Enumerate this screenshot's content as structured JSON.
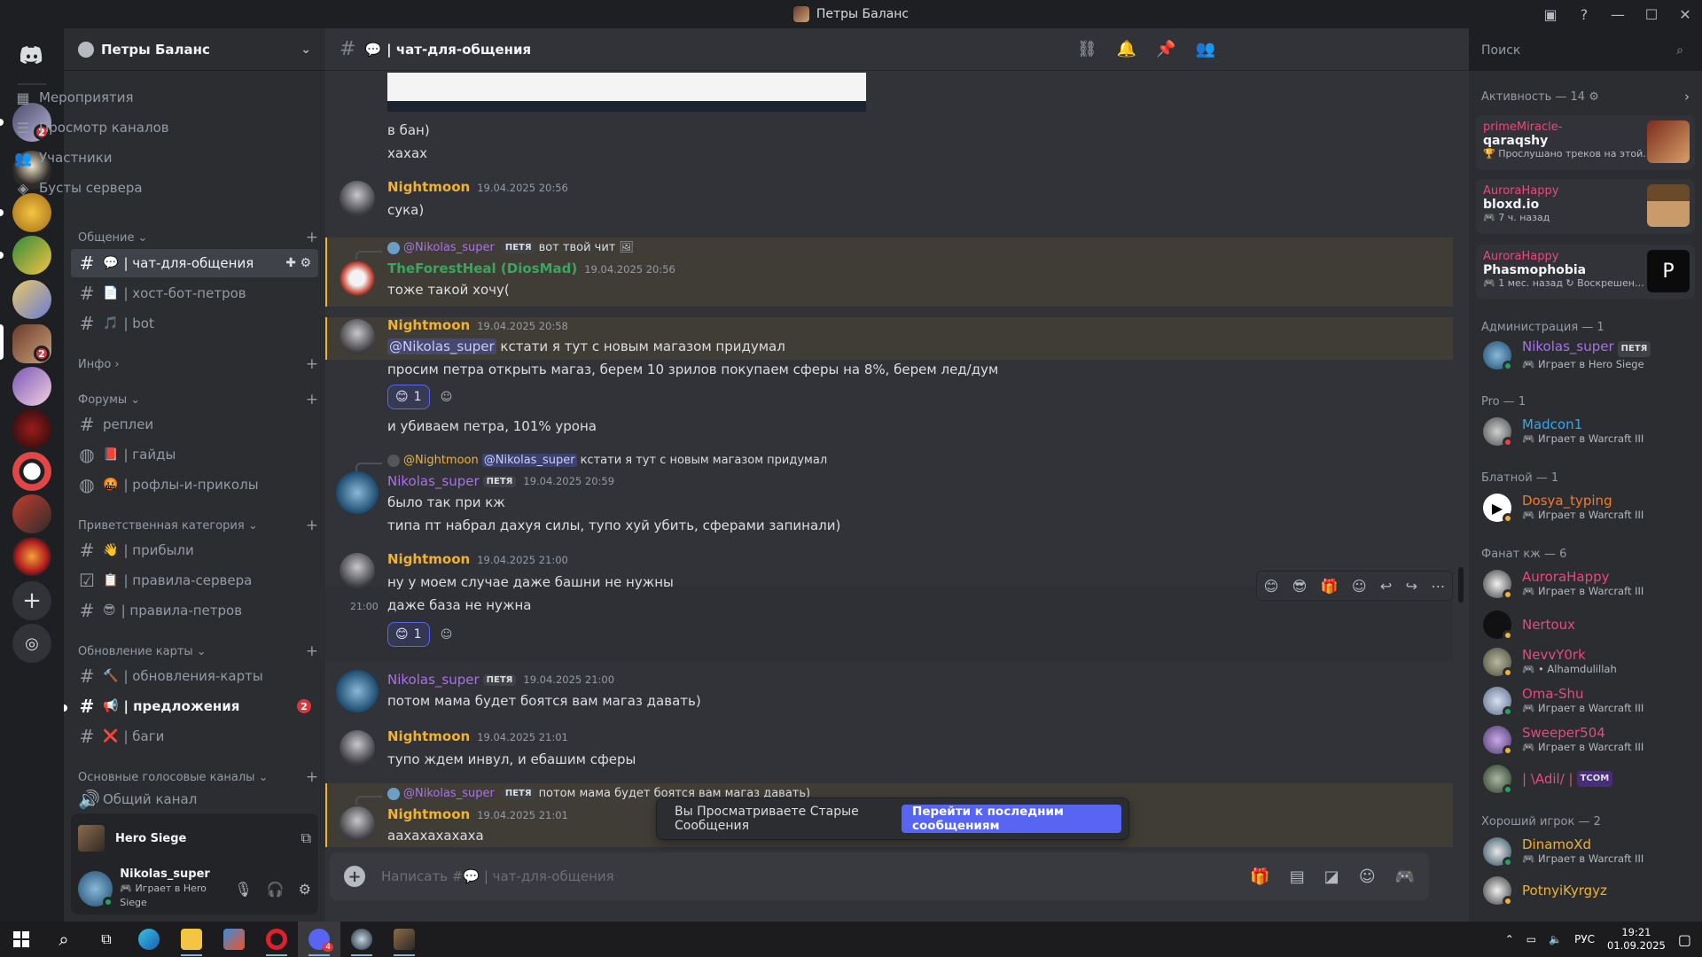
{
  "window": {
    "title": "Петры Баланс"
  },
  "server": {
    "name": "Петры Баланс"
  },
  "server_rail": {
    "badges": [
      "2",
      "2"
    ]
  },
  "nav": [
    {
      "label": "Мероприятия",
      "icon": "calendar-icon"
    },
    {
      "label": "Просмотр каналов",
      "icon": "channels-browse-icon"
    },
    {
      "label": "Участники",
      "icon": "members-icon"
    },
    {
      "label": "Бусты сервера",
      "icon": "boost-icon"
    }
  ],
  "categories": {
    "c1": "Общение",
    "c2": "Инфо",
    "c3": "Форумы",
    "c4": "Приветственная категория",
    "c5": "Обновление карты",
    "c6": "Основные голосовые каналы"
  },
  "channels": {
    "chat": {
      "emoji": "💬",
      "name": "| чат-для-общения"
    },
    "host": {
      "emoji": "📄",
      "name": "| хост-бот-петров"
    },
    "bot": {
      "emoji": "🎵",
      "name": "| bot"
    },
    "replays": {
      "name": "реплеи"
    },
    "guides": {
      "emoji": "📕",
      "name": "| гайды"
    },
    "memes": {
      "emoji": "🤬",
      "name": "| рофлы-и-приколы"
    },
    "arrived": {
      "emoji": "👋",
      "name": "| прибыли"
    },
    "rules": {
      "emoji": "📋",
      "name": "| правила-сервера"
    },
    "rules_p": {
      "emoji": "😎",
      "name": "| правила-петров"
    },
    "updates": {
      "emoji": "🔨",
      "name": "| обновления-карты"
    },
    "suggest": {
      "emoji": "📢",
      "name": "| предложения",
      "badge": "2"
    },
    "bugs": {
      "emoji": "❌",
      "name": "| баги"
    },
    "voice": {
      "name": "Общий канал"
    }
  },
  "activity_bar": {
    "game": "Hero Siege"
  },
  "user_panel": {
    "name": "Nikolas_super",
    "status": "Играет в Hero Siege"
  },
  "chat_header": {
    "emoji": "💬",
    "name": "| чат-для-общения"
  },
  "search": {
    "placeholder": "Поиск"
  },
  "messages": {
    "m0": {
      "l1": "в бан)",
      "l2": "хахах"
    },
    "m1": {
      "user": "Nightmoon",
      "time": "19.04.2025 20:56",
      "text": "сука)"
    },
    "m2": {
      "reply_user": "@Nikolas_super",
      "reply_tag": "ПЕТЯ",
      "reply_text": "вот твой чит",
      "user": "TheForestHeal (DiosMad)",
      "time": "19.04.2025 20:56",
      "text": "тоже такой хочу("
    },
    "m3": {
      "user": "Nightmoon",
      "time": "19.04.2025 20:58",
      "mention": "@Nikolas_super",
      "text1": "кстати я тут с новым магазом придумал",
      "text2": "просим петра открыть магаз, берем 10 зрилов покупаем сферы на 8%, берем лед/дум",
      "reaction": "1",
      "text3": "и убиваем петра, 101% урона"
    },
    "m4": {
      "reply_user": "@Nightmoon",
      "reply_mention": "@Nikolas_super",
      "reply_text": "кстати я тут с новым магазом придумал",
      "user": "Nikolas_super",
      "tag": "ПЕТЯ",
      "time": "19.04.2025 20:59",
      "text1": "было так при кж",
      "text2": "типа пт набрал дахуя силы, тупо хуй убить, сферами запинали)"
    },
    "m5": {
      "user": "Nightmoon",
      "time": "19.04.2025 21:00",
      "text1": "ну у моем случае даже башни не нужны",
      "hover_time": "21:00",
      "text2": "даже база не нужна",
      "reaction": "1"
    },
    "m6": {
      "user": "Nikolas_super",
      "tag": "ПЕТЯ",
      "time": "19.04.2025 21:00",
      "text": "потом мама будет боятся вам  магаз давать)"
    },
    "m7": {
      "user": "Nightmoon",
      "time": "19.04.2025 21:01",
      "text": "тупо ждем инвул, и ебашим сферы"
    },
    "m8": {
      "reply_user": "@Nikolas_super",
      "reply_tag": "ПЕТЯ",
      "reply_text": "потом мама будет боятся вам  магаз давать)",
      "user": "Nightmoon",
      "time": "19.04.2025 21:01",
      "text": "аахахахахаха"
    }
  },
  "old_banner": {
    "text": "Вы Просматриваете Старые Сообщения",
    "jump": "Перейти к последним сообщениям"
  },
  "composer": {
    "placeholder_prefix": "Написать #",
    "placeholder_emoji": "💬",
    "placeholder_channel": "| чат-для-общения"
  },
  "members": {
    "activity_header": "Активность — 14",
    "cards": [
      {
        "user": "primeMiracle-",
        "game": "qaraqshy",
        "sub": "Прослушано треков на этой…"
      },
      {
        "user": "AuroraHappy",
        "game": "bloxd.io",
        "sub": "7 ч. назад"
      },
      {
        "user": "AuroraHappy",
        "game": "Phasmophobia",
        "sub": "1 мес. назад",
        "sub2": "Воскрешен…"
      }
    ],
    "sections": {
      "admin": "Администрация — 1",
      "pro": "Pro — 1",
      "blat": "Блатной — 1",
      "fan": "Фанат кж — 6",
      "good": "Хороший игрок — 2"
    },
    "list": [
      {
        "name": "Nikolas_super",
        "tag": "ПЕТЯ",
        "sub": "Играет в Hero Siege",
        "color": "#a872e8"
      },
      {
        "name": "Madcon1",
        "sub": "Играет в Warcraft III",
        "color": "#3ba5e6"
      },
      {
        "name": "Dosya_typing",
        "sub": "Играет в Warcraft III",
        "color": "#f47b2a"
      },
      {
        "name": "AuroraHappy",
        "sub": "Играет в Warcraft III",
        "color": "#e84a7a"
      },
      {
        "name": "Nertoux",
        "color": "#e84a7a"
      },
      {
        "name": "NevvY0rk",
        "sub": "• Alhamdulillah",
        "color": "#e84a7a"
      },
      {
        "name": "Oma-Shu",
        "sub": "Играет в Warcraft III",
        "color": "#e84a7a"
      },
      {
        "name": "Sweeper504",
        "sub": "Играет в Warcraft III",
        "color": "#e84a7a"
      },
      {
        "name": "| \\Adil/ |",
        "tag": "TCOM",
        "color": "#e84a7a"
      },
      {
        "name": "DinamoXd",
        "sub": "Играет в Warcraft III",
        "color": "#f0b232"
      },
      {
        "name": "PotnyiKyrgyz",
        "color": "#f0b232"
      }
    ]
  },
  "taskbar": {
    "lang": "РУС",
    "time": "19:21",
    "date": "01.09.2025",
    "discord_badge": "4"
  },
  "colors": {
    "accent": "#5865f2",
    "nightmoon": "#f0b232",
    "forest": "#3ba55d",
    "nikolas": "#a872e8"
  }
}
